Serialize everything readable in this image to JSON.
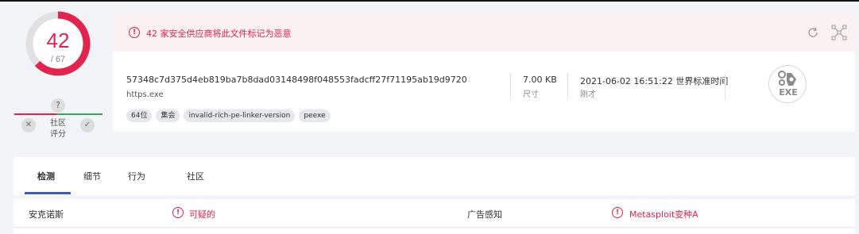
{
  "score": {
    "detections": "42",
    "total": "/ 67",
    "ratio": 0.627,
    "question": "?",
    "community_label_line1": "社区",
    "community_label_line2": "评分",
    "vote_no": "✕",
    "vote_yes": "✓"
  },
  "alert": {
    "icon": "!",
    "text": "42 家安全供应商将此文件标记为恶意"
  },
  "file": {
    "hash": "57348c7d375d4eb819ba7b8dad03148498f048553fadcff27f71195ab19d9720",
    "name": "https.exe",
    "tags": [
      "64位",
      "集会",
      "invalid-rich-pe-linker-version",
      "peexe"
    ],
    "size_value": "7.00 KB",
    "size_label": "尺寸",
    "date_value": "2021-06-02 16:51:22 世界标准时间",
    "date_label": "刚才",
    "type_badge": "EXE"
  },
  "tabs": [
    "检测",
    "细节",
    "行为",
    "社区"
  ],
  "detections": [
    {
      "engine": "安克诺斯",
      "result": "可疑的"
    },
    {
      "engine": "广告感知",
      "result": "Metasploit变种A"
    }
  ],
  "colors": {
    "malicious": "#e3234f",
    "harmless": "#3aa757",
    "tab_accent": "#3e5ab8"
  },
  "icons": [
    "reload-icon",
    "graph-icon",
    "exe-file-icon",
    "alert-icon"
  ]
}
